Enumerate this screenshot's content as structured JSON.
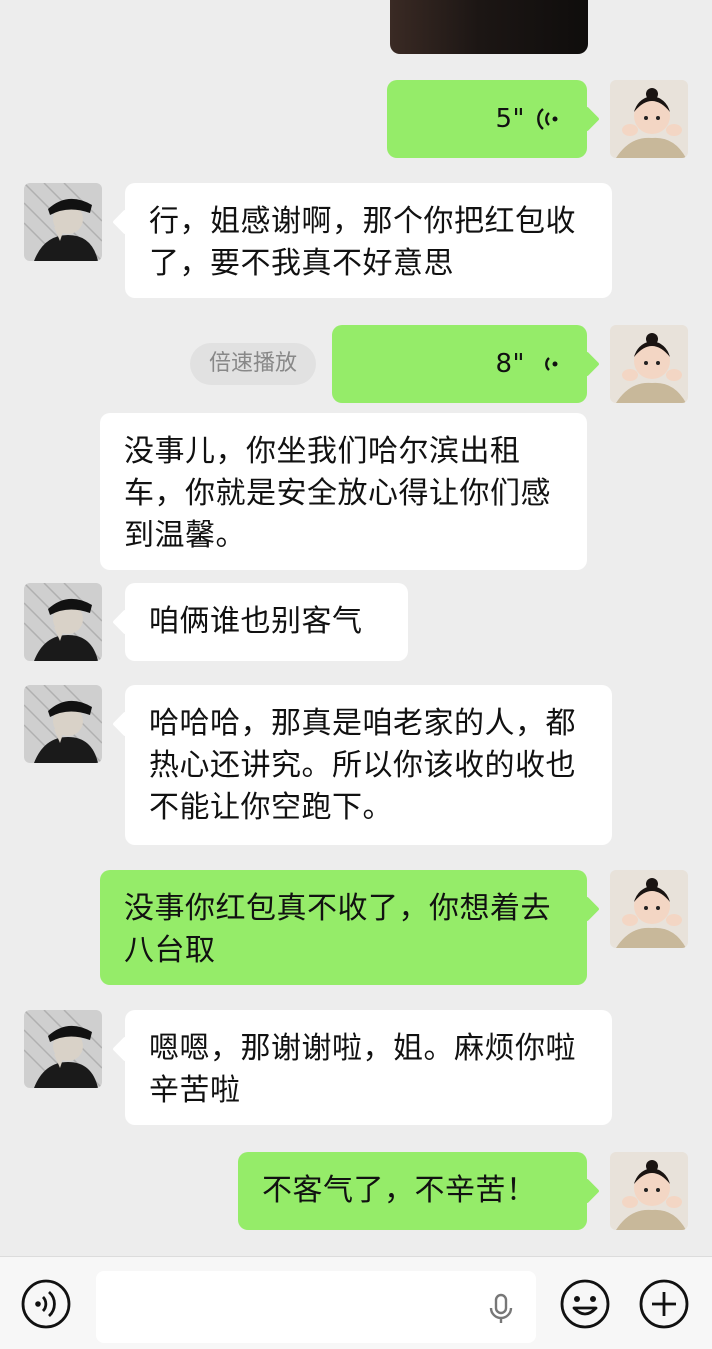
{
  "messages": [
    {
      "id": "m1",
      "type": "voice",
      "dir": "out",
      "duration": "5\""
    },
    {
      "id": "m2",
      "type": "text",
      "dir": "in",
      "text": "行，姐感谢啊，那个你把红包收了，要不我真不好意思"
    },
    {
      "id": "m3",
      "type": "voice",
      "dir": "out",
      "duration": "8\"",
      "speed_label": "倍速播放"
    },
    {
      "id": "m4",
      "type": "text",
      "dir": "in",
      "text": "没事儿，你坐我们哈尔滨出租车，你就是安全放心得让你们感到温馨。"
    },
    {
      "id": "m5",
      "type": "text",
      "dir": "in",
      "text": "咱俩谁也别客气"
    },
    {
      "id": "m6",
      "type": "text",
      "dir": "in",
      "text": "哈哈哈，那真是咱老家的人，都热心还讲究。所以你该收的收也不能让你空跑下。"
    },
    {
      "id": "m7",
      "type": "text",
      "dir": "out",
      "text": "没事你红包真不收了，你想着去八台取"
    },
    {
      "id": "m8",
      "type": "text",
      "dir": "in",
      "text": "嗯嗯，那谢谢啦，姐。麻烦你啦辛苦啦"
    },
    {
      "id": "m9",
      "type": "text",
      "dir": "out",
      "text": "不客气了，不辛苦！"
    }
  ],
  "input": {
    "value": "",
    "placeholder": ""
  },
  "icons": {
    "voice_mode": "voice-mode-icon",
    "mic": "mic-icon",
    "emoji": "emoji-icon",
    "plus": "plus-icon"
  },
  "colors": {
    "background": "#ededed",
    "out_bubble": "#95ec69",
    "in_bubble": "#ffffff"
  }
}
